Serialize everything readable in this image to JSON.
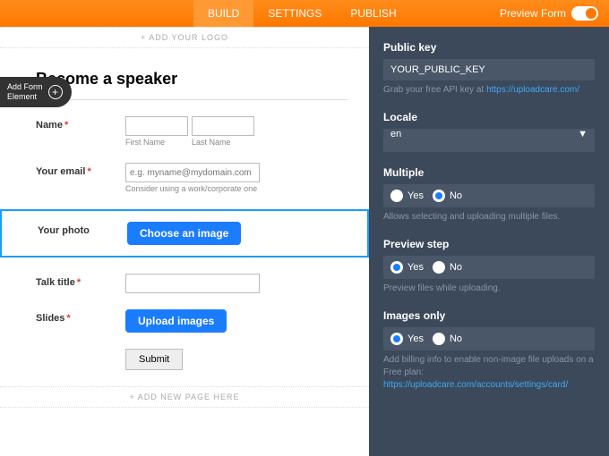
{
  "topbar": {
    "tabs": [
      "BUILD",
      "SETTINGS",
      "PUBLISH"
    ],
    "preview": "Preview Form"
  },
  "left": {
    "addLogo": "+ ADD YOUR LOGO",
    "addElement": "Add Form\nElement",
    "title": "Become a speaker",
    "name": {
      "label": "Name",
      "first": "First Name",
      "last": "Last Name"
    },
    "email": {
      "label": "Your email",
      "placeholder": "e.g. myname@mydomain.com",
      "hint": "Consider using a work/corporate one"
    },
    "photo": {
      "label": "Your photo",
      "button": "Choose an image"
    },
    "talk": {
      "label": "Talk title"
    },
    "slides": {
      "label": "Slides",
      "button": "Upload images"
    },
    "submit": "Submit",
    "addPage": "+ ADD NEW PAGE HERE"
  },
  "right": {
    "publicKey": {
      "label": "Public key",
      "value": "YOUR_PUBLIC_KEY",
      "hint": "Grab your free API key at ",
      "link": "https://uploadcare.com/"
    },
    "locale": {
      "label": "Locale",
      "value": "en"
    },
    "multiple": {
      "label": "Multiple",
      "yes": "Yes",
      "no": "No",
      "hint": "Allows selecting and uploading multiple files."
    },
    "preview": {
      "label": "Preview step",
      "yes": "Yes",
      "no": "No",
      "hint": "Preview files while uploading."
    },
    "images": {
      "label": "Images only",
      "yes": "Yes",
      "no": "No",
      "hint": "Add billing info to enable non-image file uploads on a Free plan:",
      "link": "https://uploadcare.com/accounts/settings/card/"
    }
  }
}
